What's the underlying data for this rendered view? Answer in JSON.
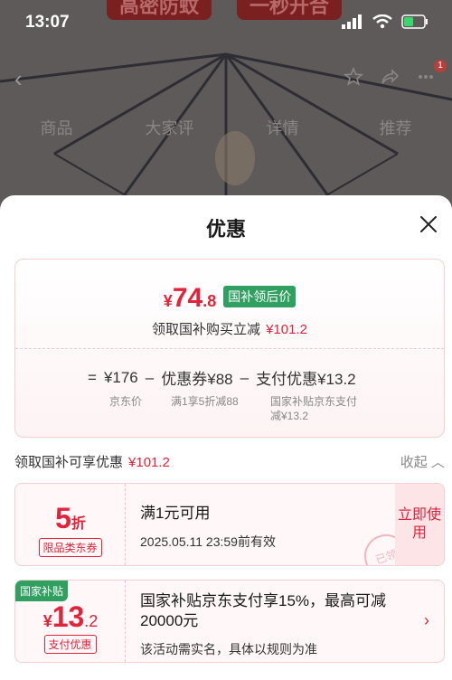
{
  "status_bar": {
    "time": "13:07"
  },
  "background": {
    "banners": [
      "高密防蚊",
      "一秒开合"
    ],
    "tabs": [
      "商品",
      "大家评",
      "详情",
      "推荐"
    ],
    "badge": "1"
  },
  "sheet": {
    "title": "优惠",
    "summary": {
      "currency": "¥",
      "price_int": "74",
      "price_dec": ".8",
      "tag": "国补领后价",
      "sub_text": "领取国补购买立减",
      "sub_amount": "¥101.2",
      "formula": {
        "eq": "=",
        "base": "¥176",
        "minus1": "–",
        "coupon": "优惠券¥88",
        "minus2": "–",
        "pay": "支付优惠¥13.2"
      },
      "labels": {
        "base": "京东价",
        "coupon": "满1享5折减88",
        "pay_line1": "国家补贴京东支付",
        "pay_line2": "减¥13.2"
      }
    },
    "section": {
      "title": "领取国补可享优惠",
      "amount": "¥101.2",
      "collapse": "收起"
    },
    "coupon1": {
      "discount": "5",
      "unit": "折",
      "type": "限品类东券",
      "condition": "满1元可用",
      "expiry": "2025.05.11 23:59前有效",
      "claim": "立即使用",
      "stamp": "已领"
    },
    "coupon2": {
      "tag": "国家补贴",
      "currency": "¥",
      "amount_int": "13",
      "amount_dec": ".2",
      "type": "支付优惠",
      "desc": "国家补贴京东支付享15%，最高可减20000元",
      "note": "该活动需实名，具体以规则为准"
    }
  }
}
